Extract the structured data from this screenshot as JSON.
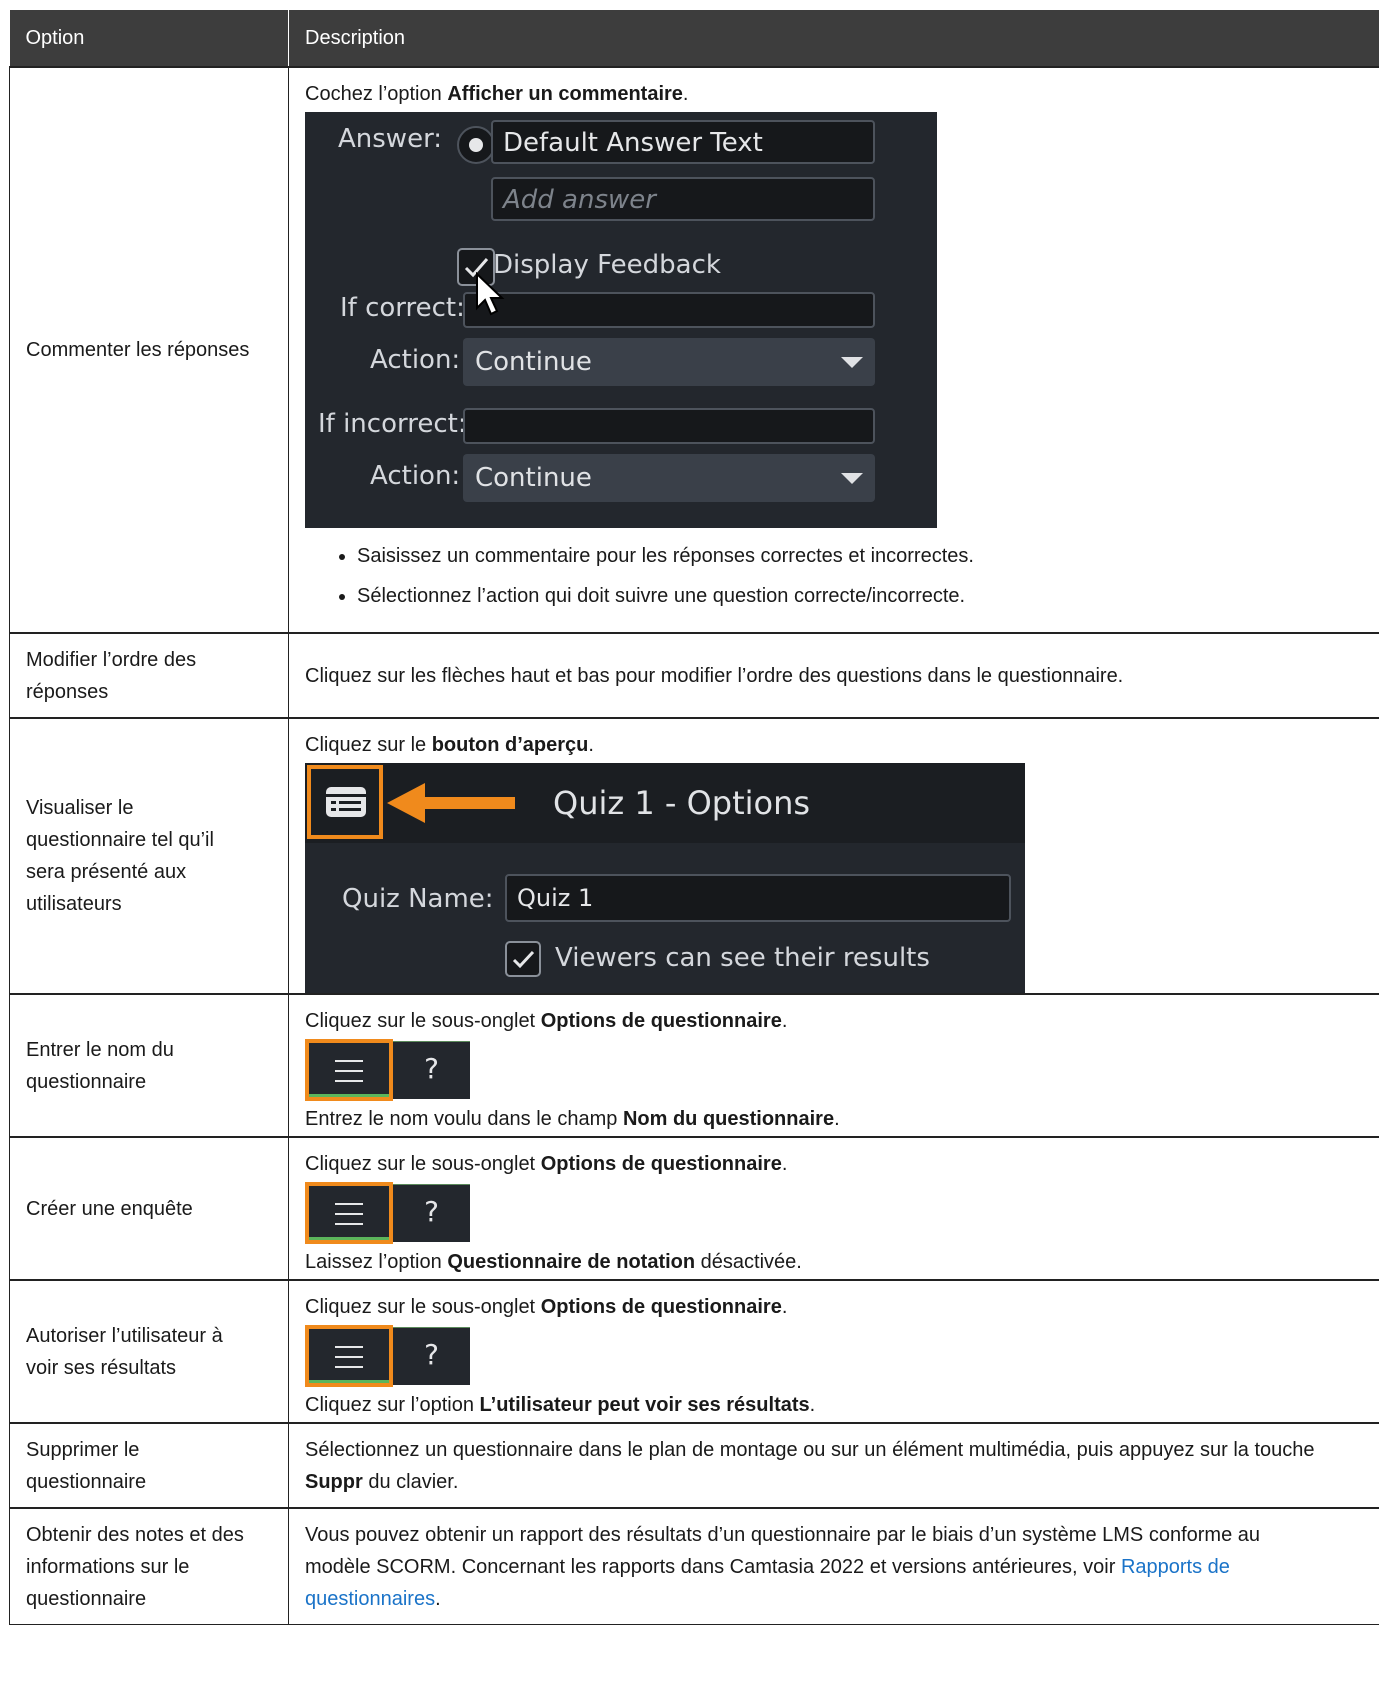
{
  "table": {
    "headers": [
      "Option",
      "Description"
    ]
  },
  "rows": {
    "r1": {
      "option": "Commenter les réponses",
      "intro_pre": "Cochez l’option ",
      "intro_bold": "Afficher un commentaire",
      "intro_post": ".",
      "screenshot": {
        "answer_label": "Answer:",
        "default_answer": "Default Answer Text",
        "add_answer_placeholder": "Add answer",
        "display_feedback": "Display Feedback",
        "if_correct": "If correct:",
        "action_label": "Action:",
        "action_value": "Continue",
        "if_incorrect": "If incorrect:",
        "action2_label": "Action:",
        "action2_value": "Continue"
      },
      "bullets": [
        "Saisissez un commentaire pour les réponses correctes et incorrectes.",
        "Sélectionnez l’action qui doit suivre une question correcte/incorrecte."
      ]
    },
    "r2": {
      "option_l1": "Modifier l’ordre des",
      "option_l2": "réponses",
      "desc": "Cliquez sur les flèches haut et bas pour modifier l’ordre des questions dans le questionnaire."
    },
    "r3": {
      "option_l1": "Visualiser le",
      "option_l2": "questionnaire tel qu’il",
      "option_l3": "sera présenté aux",
      "option_l4": "utilisateurs",
      "intro_pre": "Cliquez sur le ",
      "intro_bold": "bouton d’aperçu",
      "intro_post": ".",
      "screenshot": {
        "title": "Quiz 1 - Options",
        "quiz_name_label": "Quiz Name:",
        "quiz_name_value": "Quiz 1",
        "viewers_label": "Viewers can see their results"
      }
    },
    "r4": {
      "option_l1": "Entrer le nom du",
      "option_l2": "questionnaire",
      "intro_pre": "Cliquez sur le sous-onglet ",
      "intro_bold": "Options de questionnaire",
      "intro_post": ".",
      "tab_help": "?",
      "after_pre": "Entrez le nom voulu dans le champ ",
      "after_bold": "Nom du questionnaire",
      "after_post": "."
    },
    "r5": {
      "option": "Créer une enquête",
      "intro_pre": "Cliquez sur le sous-onglet ",
      "intro_bold": "Options de questionnaire",
      "intro_post": ".",
      "tab_help": "?",
      "after_pre": "Laissez l’option ",
      "after_bold": "Questionnaire de notation",
      "after_post": " désactivée."
    },
    "r6": {
      "option_l1": "Autoriser l’utilisateur à",
      "option_l2": "voir ses résultats",
      "intro_pre": "Cliquez sur le sous-onglet ",
      "intro_bold": "Options de questionnaire",
      "intro_post": ".",
      "tab_help": "?",
      "after_pre": "Cliquez sur l’option ",
      "after_bold": "L’utilisateur peut voir ses résultats",
      "after_post": "."
    },
    "r7": {
      "option_l1": "Supprimer le",
      "option_l2": "questionnaire",
      "desc_l1": "Sélectionnez un questionnaire dans le plan de montage ou sur un élément multimédia, puis appuyez sur la touche",
      "desc_bold": "Suppr",
      "desc_post": " du clavier."
    },
    "r8": {
      "option_l1": "Obtenir des notes et des",
      "option_l2": "informations sur le",
      "option_l3": "questionnaire",
      "desc_l1": "Vous pouvez obtenir un rapport des résultats d’un questionnaire par le biais d’un système LMS conforme au",
      "desc_l2": "modèle SCORM. Concernant les rapports dans Camtasia 2022 et versions antérieures, voir ",
      "link_l1": "Rapports de",
      "link_l2": "questionnaires",
      "desc_post": "."
    }
  },
  "colors": {
    "header_bg": "#3d3d3d",
    "highlight": "#f08a1c",
    "link": "#1a73c8",
    "panel_bg": "#23272d"
  }
}
